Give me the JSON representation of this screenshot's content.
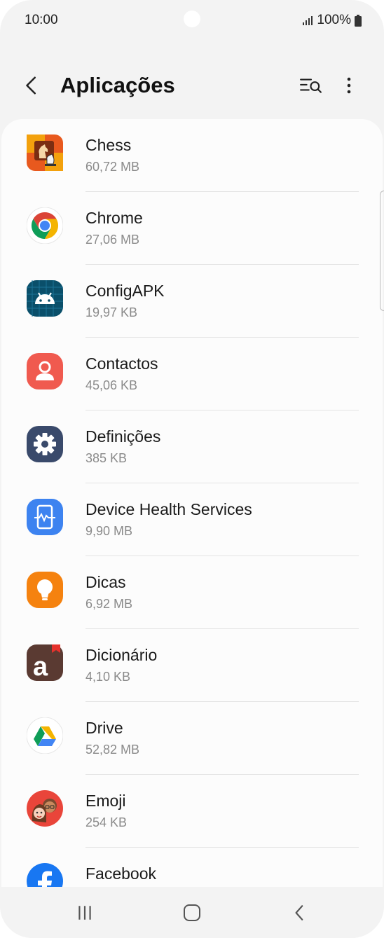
{
  "status_bar": {
    "time": "10:00",
    "battery": "100%",
    "icons": [
      "signal-icon",
      "battery-icon"
    ]
  },
  "header": {
    "title": "Aplicações",
    "icons": [
      "back-arrow-icon",
      "search-filter-icon",
      "more-vertical-icon"
    ]
  },
  "apps": [
    {
      "name": "Chess",
      "size": "60,72 MB",
      "icon": "chess-icon"
    },
    {
      "name": "Chrome",
      "size": "27,06 MB",
      "icon": "chrome-icon"
    },
    {
      "name": "ConfigAPK",
      "size": "19,97 KB",
      "icon": "android-icon"
    },
    {
      "name": "Contactos",
      "size": "45,06 KB",
      "icon": "contacts-icon"
    },
    {
      "name": "Definições",
      "size": "385 KB",
      "icon": "settings-gear-icon"
    },
    {
      "name": "Device Health Services",
      "size": "9,90 MB",
      "icon": "device-health-icon"
    },
    {
      "name": "Dicas",
      "size": "6,92 MB",
      "icon": "lightbulb-icon"
    },
    {
      "name": "Dicionário",
      "size": "4,10 KB",
      "icon": "dictionary-icon"
    },
    {
      "name": "Drive",
      "size": "52,82 MB",
      "icon": "google-drive-icon"
    },
    {
      "name": "Emoji",
      "size": "254 KB",
      "icon": "emoji-avatar-icon"
    },
    {
      "name": "Facebook",
      "size": "",
      "icon": "facebook-icon"
    }
  ],
  "nav_bar": {
    "icons": [
      "recent-apps-icon",
      "home-icon",
      "back-icon"
    ]
  },
  "colors": {
    "background": "#f3f3f3",
    "card": "#fcfcfc",
    "title": "#111111",
    "secondary_text": "#8a8a8a"
  }
}
